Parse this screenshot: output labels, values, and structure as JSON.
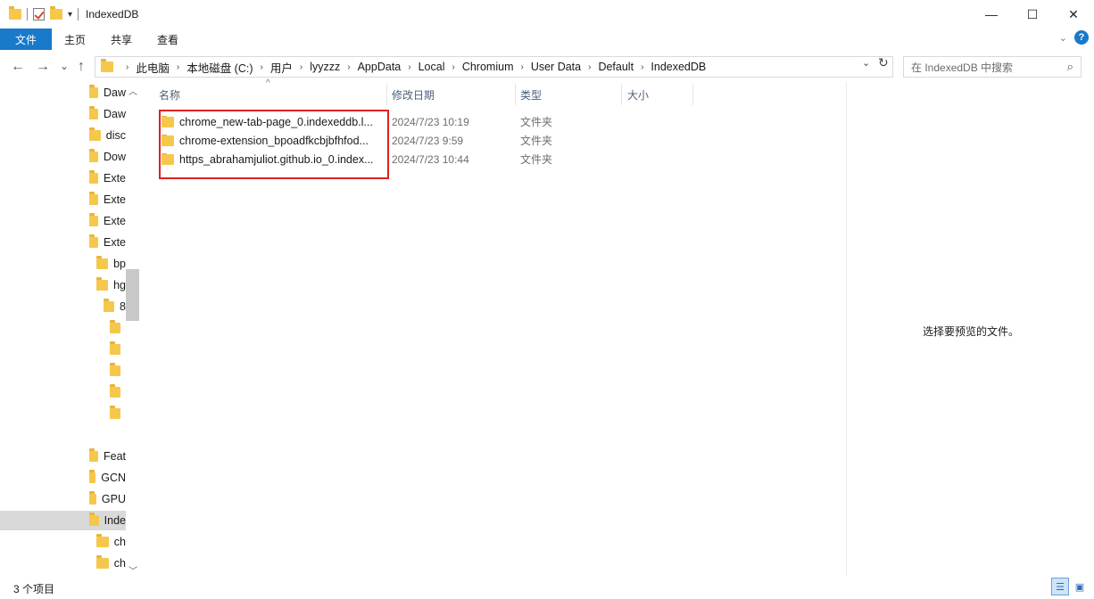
{
  "window": {
    "title": "IndexedDB",
    "controls": {
      "minimize": "—",
      "maximize": "☐",
      "close": "✕"
    }
  },
  "ribbon": {
    "tabs": [
      "文件",
      "主页",
      "共享",
      "查看"
    ],
    "help_icon": "?"
  },
  "nav": {
    "back": "←",
    "forward": "→",
    "recent": "⌄",
    "up": "↑"
  },
  "address": {
    "crumbs": [
      "此电脑",
      "本地磁盘 (C:)",
      "用户",
      "lyyzzz",
      "AppData",
      "Local",
      "Chromium",
      "User Data",
      "Default",
      "IndexedDB"
    ]
  },
  "search": {
    "placeholder": "在 IndexedDB 中搜索"
  },
  "sidebar": {
    "items": [
      {
        "label": "Daw"
      },
      {
        "label": "Daw"
      },
      {
        "label": "disc"
      },
      {
        "label": "Dow"
      },
      {
        "label": "Exte"
      },
      {
        "label": "Exte"
      },
      {
        "label": "Exte"
      },
      {
        "label": "Exte"
      },
      {
        "label": "bp"
      },
      {
        "label": "hg"
      },
      {
        "label": "8"
      },
      {
        "label": ""
      },
      {
        "label": ""
      },
      {
        "label": ""
      },
      {
        "label": ""
      },
      {
        "label": ""
      },
      {
        "label": "Feat"
      },
      {
        "label": "GCN"
      },
      {
        "label": "GPU"
      },
      {
        "label": "Inde"
      },
      {
        "label": "ch"
      },
      {
        "label": "ch"
      }
    ]
  },
  "columns": {
    "name": "名称",
    "modified": "修改日期",
    "type": "类型",
    "size": "大小"
  },
  "files": [
    {
      "name": "chrome_new-tab-page_0.indexeddb.l...",
      "modified": "2024/7/23 10:19",
      "type": "文件夹"
    },
    {
      "name": "chrome-extension_bpoadfkcbjbfhfod...",
      "modified": "2024/7/23 9:59",
      "type": "文件夹"
    },
    {
      "name": "https_abrahamjuliot.github.io_0.index...",
      "modified": "2024/7/23 10:44",
      "type": "文件夹"
    }
  ],
  "preview": {
    "message": "选择要预览的文件。"
  },
  "status": {
    "count": "3 个项目"
  },
  "colors": {
    "accent": "#1979ca",
    "highlight": "#e02020",
    "folder": "#f5c84c"
  }
}
